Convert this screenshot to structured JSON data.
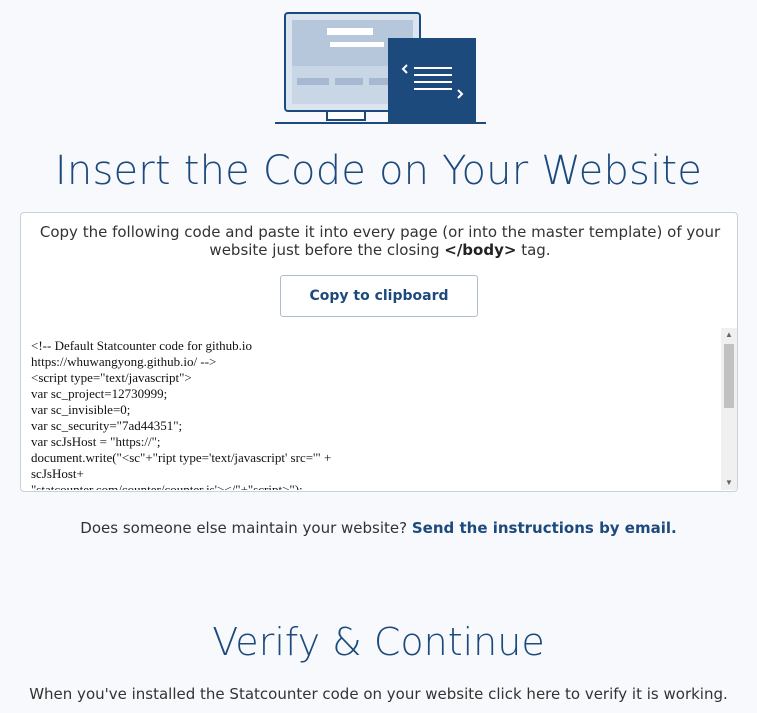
{
  "header": {
    "illustration": "website-code-icon",
    "title": "Insert the Code on Your Website"
  },
  "instructions": {
    "text_before": "Copy the following code and paste it into every page (or into the master template) of your website just before the closing ",
    "tag": "</body>",
    "text_after": " tag."
  },
  "copy_button": {
    "label": "Copy to clipboard"
  },
  "code": {
    "lines": [
      "<!-- Default Statcounter code for github.io",
      "https://whuwangyong.github.io/ -->",
      "<script type=\"text/javascript\">",
      "var sc_project=12730999;",
      "var sc_invisible=0;",
      "var sc_security=\"7ad44351\";",
      "var scJsHost = \"https://\";",
      "document.write(\"<sc\"+\"ript type='text/javascript' src='\" +",
      "scJsHost+",
      "\"statcounter.com/counter/counter.js'></\"+\"script>\");"
    ]
  },
  "email": {
    "question": "Does someone else maintain your website? ",
    "link": "Send the instructions by email."
  },
  "verify": {
    "title": "Verify & Continue",
    "text": "When you've installed the Statcounter code on your website click here to verify it is working."
  },
  "colors": {
    "accent": "#1d4a7d",
    "background": "#f7f9fc",
    "panel_border": "#c7d1dc"
  }
}
